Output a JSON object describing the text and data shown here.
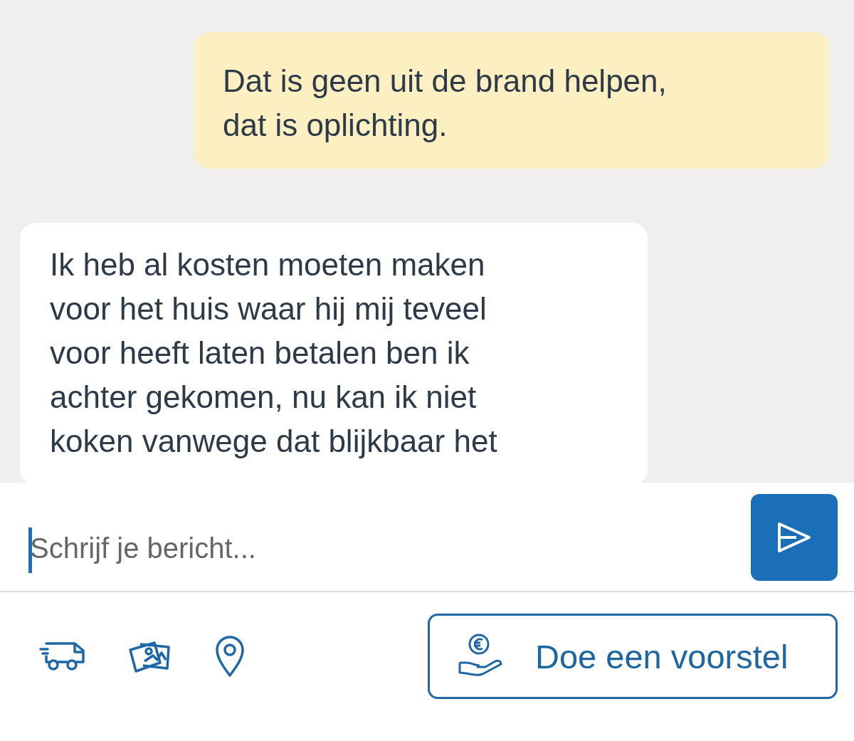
{
  "messages": [
    {
      "kind": "sent",
      "text": "Dat is geen uit de brand helpen,\ndat is oplichting."
    },
    {
      "kind": "received",
      "text": "Ik heb al kosten moeten maken\nvoor het huis waar hij mij teveel\nvoor heeft laten betalen ben ik\nachter gekomen, nu kan ik niet\nkoken vanwege dat blijkbaar het"
    }
  ],
  "composer": {
    "placeholder": "Schrijf je bericht...",
    "focused": true
  },
  "offer_button": {
    "label": "Doe een voorstel"
  }
}
